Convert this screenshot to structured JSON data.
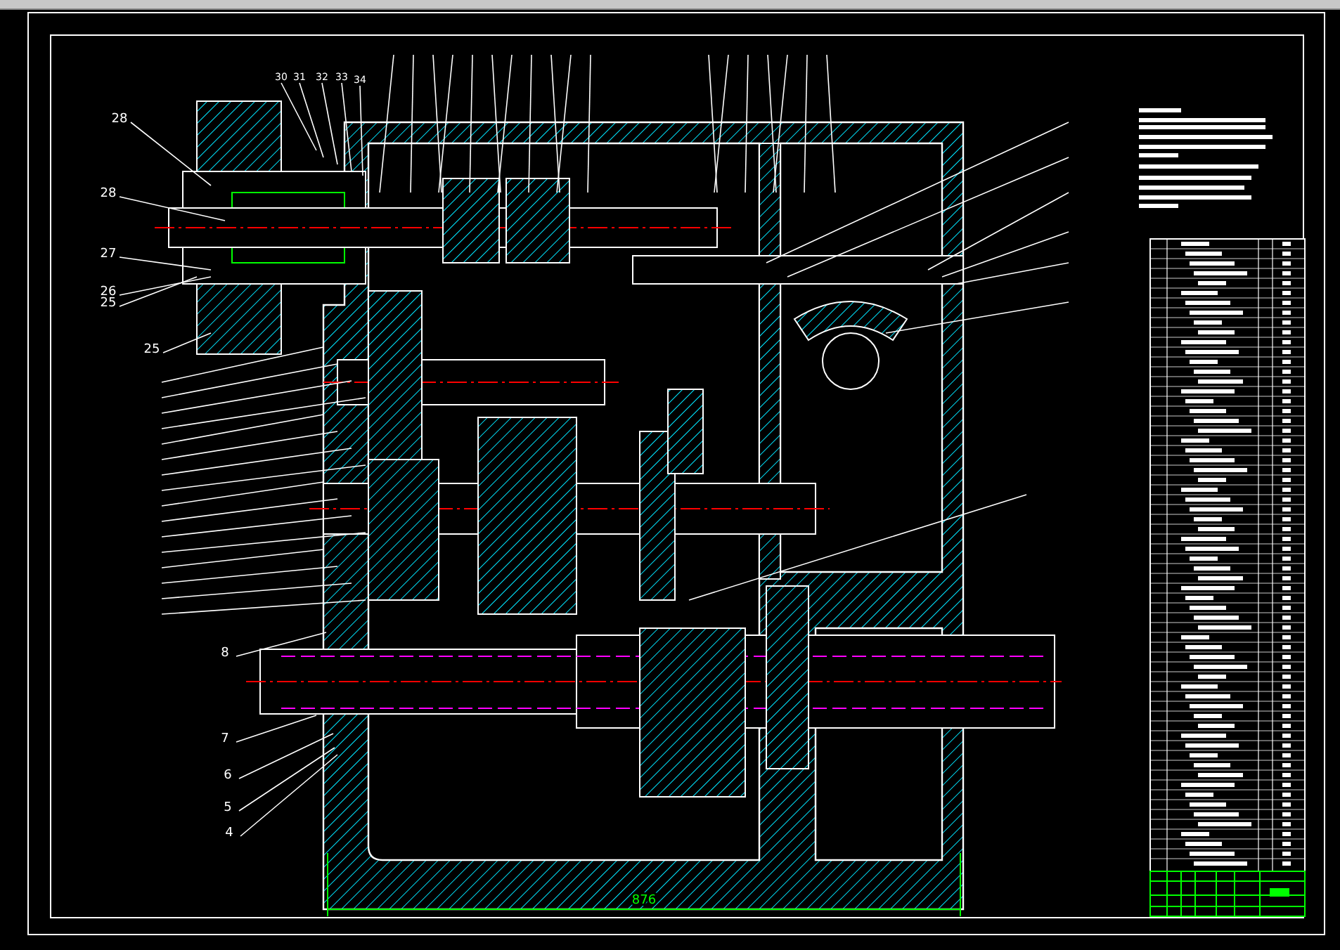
{
  "drawing": {
    "left_part_numbers": [
      "28",
      "28",
      "27",
      "26",
      "25",
      "25"
    ],
    "top_part_numbers": [
      "30",
      "31",
      "32",
      "33",
      "34"
    ],
    "bottom_part_numbers": [
      "8",
      "7",
      "6",
      "5",
      "4"
    ],
    "dimension": "876"
  }
}
